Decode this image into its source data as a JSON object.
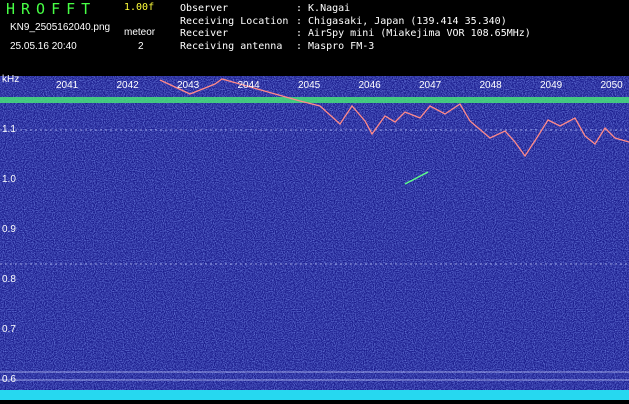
{
  "header": {
    "logo": "HROFFT",
    "version": "1.00f",
    "filename": "KN9_2505162040.png",
    "datetime": "25.05.16 20:40",
    "meteor_label": "meteor",
    "meteor_count": "2"
  },
  "info": [
    {
      "key": "Observer",
      "value": ": K.Nagai"
    },
    {
      "key": "Receiving Location",
      "value": ": Chigasaki, Japan (139.414 35.340)"
    },
    {
      "key": "Receiver",
      "value": ": AirSpy mini (Miakejima VOR 108.65MHz)"
    },
    {
      "key": "Receiving antenna",
      "value": ": Maspro FM-3"
    }
  ],
  "y_axis": {
    "unit": "kHz",
    "ticks": [
      "1.1",
      "1.0",
      "0.9",
      "0.8",
      "0.7",
      "0.6"
    ]
  },
  "x_axis": {
    "ticks": [
      "2041",
      "2042",
      "2043",
      "2044",
      "2045",
      "2046",
      "2047",
      "2048",
      "2049",
      "2050"
    ]
  },
  "colors": {
    "background": "#1a1c8c",
    "carrier": "#46e07a",
    "trace": "#ff8a8a",
    "noise_floor": "#26d8f0",
    "logo": "#47ff45",
    "version": "#ffff3a"
  }
}
